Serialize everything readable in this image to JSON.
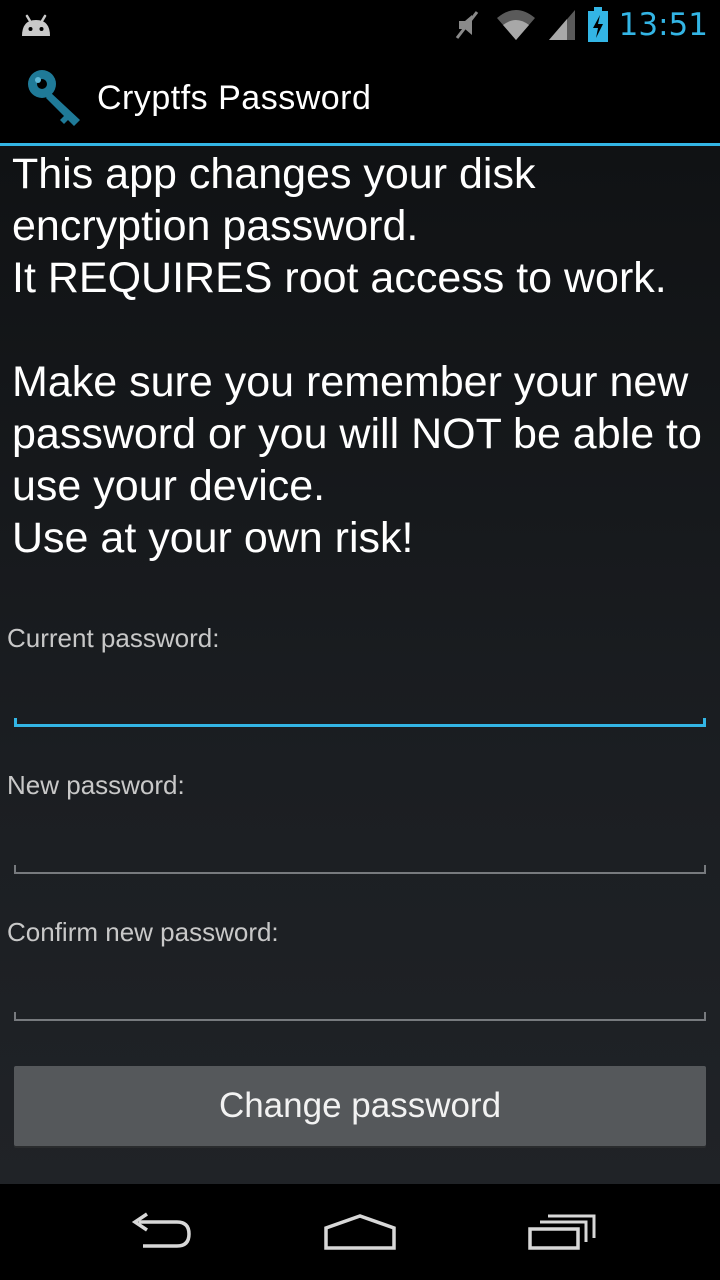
{
  "status_bar": {
    "time": "13:51",
    "icons": [
      "android-debug-icon",
      "mute-icon",
      "wifi-icon",
      "signal-icon",
      "battery-charging-icon"
    ],
    "accent_color": "#33b5e5"
  },
  "action_bar": {
    "title": "Cryptfs Password",
    "icon": "key-icon"
  },
  "main": {
    "intro_text": "This app changes your disk\nencryption password.\nIt REQUIRES root access to work.\n\nMake sure you remember your new password or you will NOT be able to use your device.\nUse at your own risk!",
    "fields": [
      {
        "label": "Current password:",
        "value": "",
        "focused": true
      },
      {
        "label": "New password:",
        "value": "",
        "focused": false
      },
      {
        "label": "Confirm new password:",
        "value": "",
        "focused": false
      }
    ],
    "button_label": "Change password"
  },
  "nav_bar": {
    "buttons": [
      "back-icon",
      "home-icon",
      "recents-icon"
    ]
  }
}
